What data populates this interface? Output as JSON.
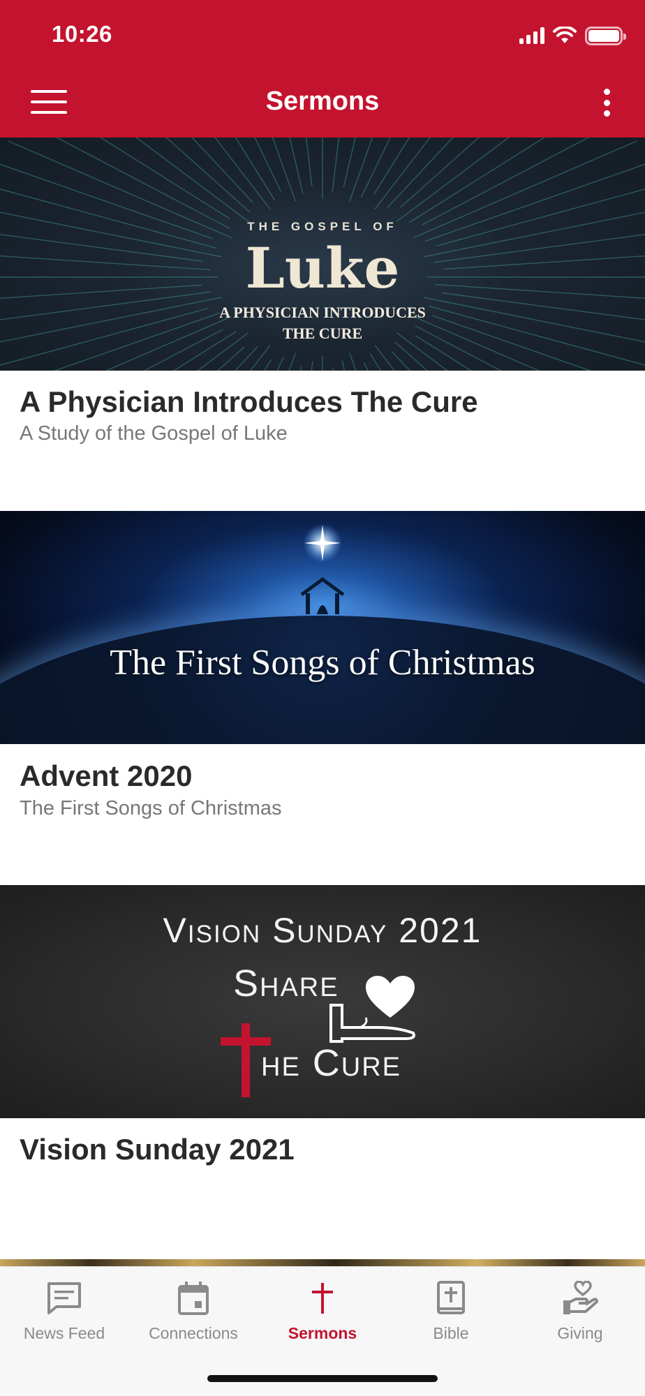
{
  "status_bar": {
    "time": "10:26"
  },
  "header": {
    "title": "Sermons"
  },
  "sermons": [
    {
      "title": "A Physician Introduces The Cure",
      "subtitle": "A Study of the Gospel of Luke",
      "banner": {
        "line1": "THE GOSPEL OF",
        "line2": "Luke",
        "line3": "A PHYSICIAN INTRODUCES",
        "line4": "THE CURE"
      }
    },
    {
      "title": "Advent 2020",
      "subtitle": "The First Songs of Christmas",
      "banner": {
        "line1": "The First Songs of Christmas"
      }
    },
    {
      "title": "Vision Sunday 2021",
      "subtitle": "",
      "banner": {
        "line1": "Vision Sunday 2021",
        "line2": "Share",
        "line3": "he Cure"
      }
    }
  ],
  "tabs": [
    {
      "label": "News Feed",
      "icon": "news-feed-icon",
      "active": false
    },
    {
      "label": "Connections",
      "icon": "calendar-icon",
      "active": false
    },
    {
      "label": "Sermons",
      "icon": "cross-icon",
      "active": true
    },
    {
      "label": "Bible",
      "icon": "bible-icon",
      "active": false
    },
    {
      "label": "Giving",
      "icon": "giving-icon",
      "active": false
    }
  ],
  "colors": {
    "brand": "#c4132f",
    "tab_inactive": "#8a8a8a",
    "title_text": "#2a2a2a",
    "subtitle_text": "#777777"
  }
}
